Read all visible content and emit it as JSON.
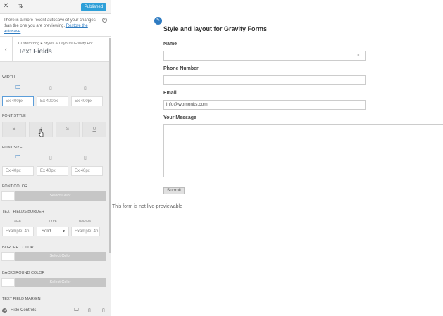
{
  "topbar": {
    "close_icon": "close-icon",
    "swap_icon": "arrows-icon",
    "publish_label": "Published",
    "accent": "#2e9fd8"
  },
  "notice": {
    "text_line1": "There is a more recent autosave of your changes",
    "text_line2_prefix": "than the one you are previewing. ",
    "restore_link": "Restore the",
    "text_line3": "autosave"
  },
  "section": {
    "breadcrumb": "Customizing ▸ Styles & Layouts Gravity For…",
    "title": "Text Fields"
  },
  "width": {
    "label": "Width",
    "inputs": [
      "Ex 400px",
      "Ex 400px",
      "Ex 400px"
    ]
  },
  "font_style": {
    "label": "Font Style",
    "buttons": [
      "B",
      "I",
      "S",
      "U"
    ]
  },
  "font_size": {
    "label": "Font Size",
    "inputs": [
      "Ex 40px",
      "Ex 40px",
      "Ex 40px"
    ]
  },
  "font_color": {
    "label": "Font Color",
    "button": "Select Color"
  },
  "border": {
    "label": "Text Fields Border",
    "size_label": "Size",
    "type_label": "Type",
    "radius_label": "Radius",
    "size_placeholder": "Example: 4p",
    "type_value": "Solid",
    "radius_placeholder": "Example: 4p"
  },
  "border_color": {
    "label": "Border Color",
    "button": "Select Color"
  },
  "background_color": {
    "label": "Background Color",
    "button": "Select Color"
  },
  "margin": {
    "label": "Text Field Margin"
  },
  "footer": {
    "hide_label": "Hide Controls"
  },
  "preview": {
    "form_title": "Style and layout for Gravity Forms",
    "fields": {
      "name_label": "Name",
      "phone_label": "Phone Number",
      "email_label": "Email",
      "email_value": "info@wpmonks.com",
      "message_label": "Your Message"
    },
    "submit_label": "Submit",
    "note": "This form is not live-previewable"
  }
}
